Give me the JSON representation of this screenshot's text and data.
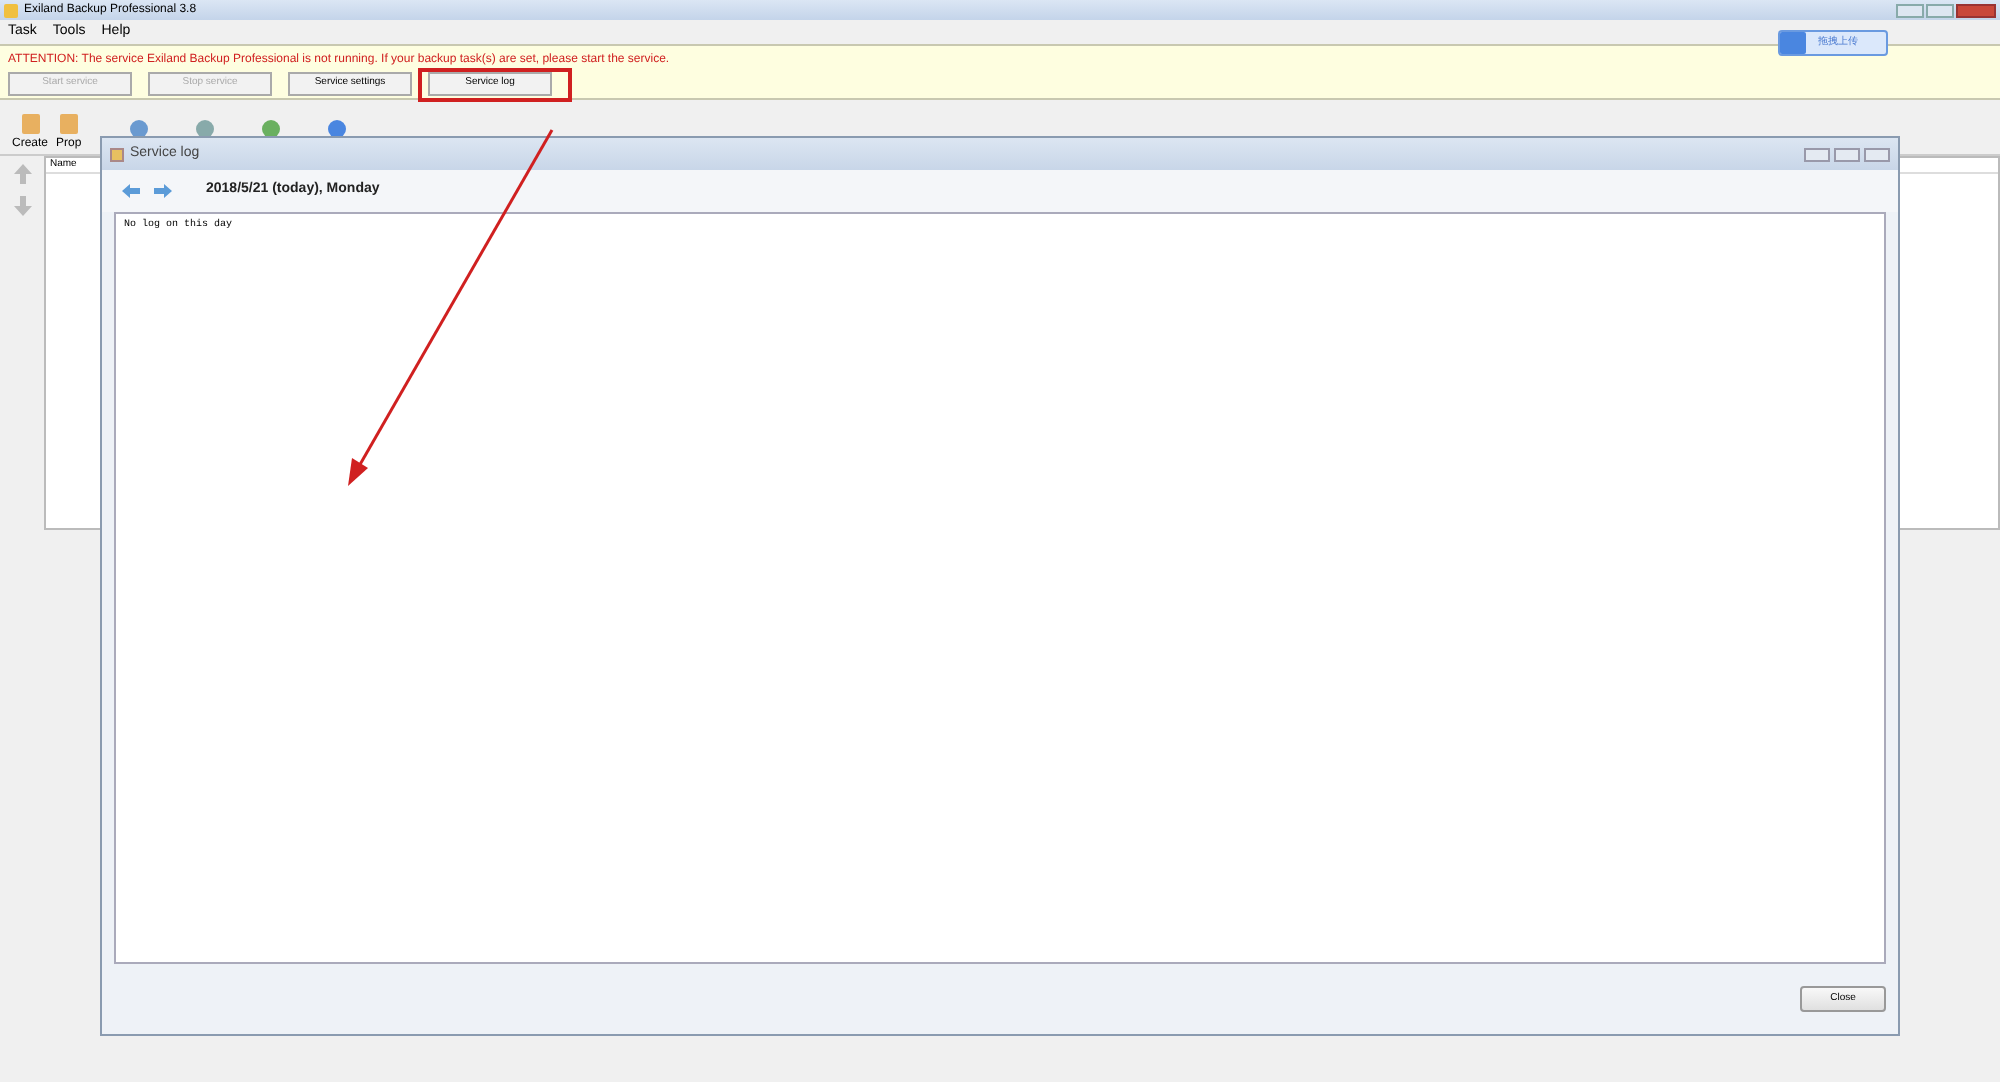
{
  "window": {
    "title": "Exiland Backup Professional 3.8"
  },
  "menu": [
    "Task",
    "Tools",
    "Help"
  ],
  "notice": {
    "text": "ATTENTION: The service Exiland Backup Professional is not running. If your backup task(s) are set, please start the service."
  },
  "service_buttons": [
    {
      "label": "Start service",
      "disabled": true
    },
    {
      "label": "Stop service",
      "disabled": true
    },
    {
      "label": "Service settings",
      "disabled": false
    },
    {
      "label": "Service log",
      "disabled": false
    }
  ],
  "upload_button": {
    "label": "拖拽上传"
  },
  "toolbar": [
    {
      "label": "Create"
    },
    {
      "label": "Prop"
    }
  ],
  "task_list": {
    "columns": [
      "Name"
    ]
  },
  "dialog": {
    "title": "Service log",
    "date": "2018/5/21 (today), Monday",
    "log_text": "No log on this day",
    "close_label": "Close"
  }
}
